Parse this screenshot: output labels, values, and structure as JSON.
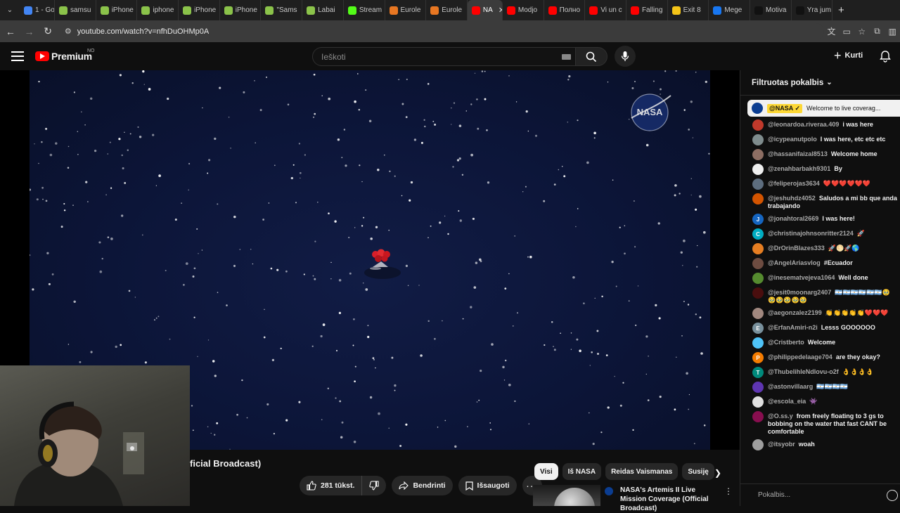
{
  "browser": {
    "tabs": [
      {
        "label": "1 - Go",
        "icon": "google-icon",
        "color": "#4285f4"
      },
      {
        "label": "samsu",
        "icon": "plus-icon",
        "color": "#8bc34a"
      },
      {
        "label": "iPhone",
        "icon": "plus-icon",
        "color": "#8bc34a"
      },
      {
        "label": "iphone",
        "icon": "plus-icon",
        "color": "#8bc34a"
      },
      {
        "label": "iPhone",
        "icon": "plus-icon",
        "color": "#8bc34a"
      },
      {
        "label": "iPhone",
        "icon": "plus-icon",
        "color": "#8bc34a"
      },
      {
        "label": "\"Sams",
        "icon": "plus-icon",
        "color": "#8bc34a"
      },
      {
        "label": "Labai",
        "icon": "plus-icon",
        "color": "#8bc34a"
      },
      {
        "label": "Stream",
        "icon": "kick-icon",
        "color": "#53fc18"
      },
      {
        "label": "Eurole",
        "icon": "euroleague-icon",
        "color": "#e87722"
      },
      {
        "label": "Eurole",
        "icon": "euroleague-icon",
        "color": "#e87722"
      },
      {
        "label": "NA",
        "icon": "youtube-icon",
        "color": "#ff0000",
        "active": true
      },
      {
        "label": "Modjo",
        "icon": "youtube-icon",
        "color": "#ff0000"
      },
      {
        "label": "Полно",
        "icon": "youtube-icon",
        "color": "#ff0000"
      },
      {
        "label": "Vi un c",
        "icon": "youtube-icon",
        "color": "#ff0000"
      },
      {
        "label": "Falling",
        "icon": "youtube-icon",
        "color": "#ff0000"
      },
      {
        "label": "Exit 8",
        "icon": "exit8-icon",
        "color": "#f5c518"
      },
      {
        "label": "Mege",
        "icon": "facebook-icon",
        "color": "#1877f2"
      },
      {
        "label": "Motiva",
        "icon": "tiktok-icon",
        "color": "#111111"
      },
      {
        "label": "Yra jum",
        "icon": "tiktok-icon",
        "color": "#111111"
      }
    ],
    "url": "youtube.com/watch?v=nfhDuOHMp0A"
  },
  "youtube": {
    "logo_text": "Premium",
    "logo_badge": "NO",
    "search_placeholder": "Ieškoti",
    "create_label": "Kurti",
    "brand_color": "#ff0000"
  },
  "video": {
    "title_visible": "ficial Broadcast)",
    "like_count": "281 tūkst.",
    "share_label": "Bendrinti",
    "save_label": "Išsaugoti",
    "overlay_logo": "NASA"
  },
  "recommendations": {
    "chips": [
      "Visi",
      "Iš NASA",
      "Reidas Vaismanas",
      "Susiję"
    ],
    "items": [
      {
        "title": "NASA's Artemis II Live Mission Coverage (Official Broadcast)"
      }
    ]
  },
  "chat": {
    "header": "Filtruotas pokalbis",
    "pinned": {
      "author": "@NASA ✓",
      "text": "Welcome to live coverag..."
    },
    "messages": [
      {
        "author": "@leonardoa.riveraa.409",
        "text": "i was here",
        "avatar_color": "#c0392b",
        "initial": ""
      },
      {
        "author": "@icypeanutpolo",
        "text": "I was here, etc etc etc",
        "avatar_color": "#7f8c8d",
        "initial": ""
      },
      {
        "author": "@hassanifaizal8513",
        "text": "Welcome home",
        "avatar_color": "#8d6e63",
        "initial": ""
      },
      {
        "author": "@zenahbarbakh9301",
        "text": "By",
        "avatar_color": "#eeeeee",
        "initial": ""
      },
      {
        "author": "@feliperojas3634",
        "text": "❤️❤️❤️❤️❤️❤️",
        "avatar_color": "#5d6d7e",
        "initial": ""
      },
      {
        "author": "@jeshuhdz4052",
        "text": "Saludos a mi bb que anda trabajando",
        "avatar_color": "#d35400",
        "initial": ""
      },
      {
        "author": "@jonahtoral2669",
        "text": "I was here!",
        "avatar_color": "#1565c0",
        "initial": "J"
      },
      {
        "author": "@christinajohnsonritter2124",
        "text": "🚀",
        "avatar_color": "#00acc1",
        "initial": "C"
      },
      {
        "author": "@DrOrinBlazes333",
        "text": "🚀🌕🚀🌎",
        "avatar_color": "#e67e22",
        "initial": ""
      },
      {
        "author": "@AngelAriasvlog",
        "text": "#Ecuador",
        "avatar_color": "#6d4c41",
        "initial": ""
      },
      {
        "author": "@inesematvejeva1064",
        "text": "Well done",
        "avatar_color": "#558b2f",
        "initial": ""
      },
      {
        "author": "@jesit0moonarg2407",
        "text": "🇦🇷🇦🇷🇦🇷🇦🇷🇦🇷🇦🇷🥹🥹🥹🥹🥹🥹",
        "avatar_color": "#4a0e0e",
        "initial": ""
      },
      {
        "author": "@aegonzalez2199",
        "text": "👏👏👏👏👏❤️❤️❤️",
        "avatar_color": "#a1887f",
        "initial": ""
      },
      {
        "author": "@ErfanAmiri-n2i",
        "text": "Lesss GOOOOOO",
        "avatar_color": "#78909c",
        "initial": "E"
      },
      {
        "author": "@Cristberto",
        "text": "Welcome",
        "avatar_color": "#4fc3f7",
        "initial": ""
      },
      {
        "author": "@philippedelaage704",
        "text": "are they okay?",
        "avatar_color": "#f57c00",
        "initial": "P"
      },
      {
        "author": "@ThubelihleNdlovu-o2f",
        "text": "👌👌👌👌",
        "avatar_color": "#00897b",
        "initial": "T"
      },
      {
        "author": "@astonvillaarg",
        "text": "🇦🇷🇦🇷🇦🇷🇦🇷",
        "avatar_color": "#5e35b1",
        "initial": ""
      },
      {
        "author": "@escola_eia",
        "text": "👾",
        "avatar_color": "#e0e0e0",
        "initial": ""
      },
      {
        "author": "@O.ss.y",
        "text": "from freely floating to 3 gs to bobbing on the water that fast CANT be comfortable",
        "avatar_color": "#880e4f",
        "initial": ""
      },
      {
        "author": "@itsyobr",
        "text": "woah",
        "avatar_color": "#9e9e9e",
        "initial": ""
      }
    ],
    "input_placeholder": "Pokalbis..."
  }
}
